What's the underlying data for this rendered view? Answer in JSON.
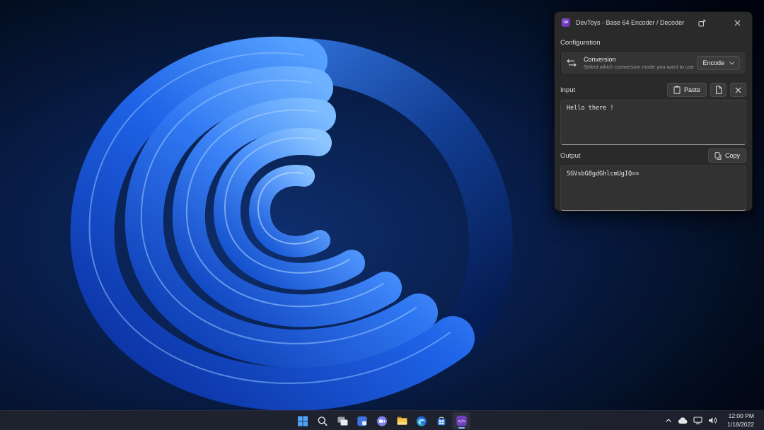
{
  "app_window": {
    "title": "DevToys - Base 64 Encoder / Decoder",
    "configuration": {
      "section_label": "Configuration",
      "conversion_title": "Conversion",
      "conversion_description": "Select which conversion mode you want to use",
      "conversion_mode": "Encode"
    },
    "input": {
      "section_label": "Input",
      "paste_button": "Paste",
      "value": "Hello there !"
    },
    "output": {
      "section_label": "Output",
      "copy_button": "Copy",
      "value": "SGVsbG8gdGhlcmUgIQ=="
    }
  },
  "taskbar": {
    "icons": [
      {
        "name": "start"
      },
      {
        "name": "search"
      },
      {
        "name": "task-view"
      },
      {
        "name": "widgets"
      },
      {
        "name": "teams"
      },
      {
        "name": "file-explorer"
      },
      {
        "name": "edge"
      },
      {
        "name": "microsoft-store"
      },
      {
        "name": "devtoys",
        "active": true
      }
    ],
    "tray": {
      "time": "12:00 PM",
      "date": "1/18/2022"
    }
  },
  "colors": {
    "accent_blue": "#2e6bff",
    "devtoys_purple": "#6f3fbf",
    "window_bg": "#2b2b2b",
    "taskbar_bg": "#20232e"
  }
}
